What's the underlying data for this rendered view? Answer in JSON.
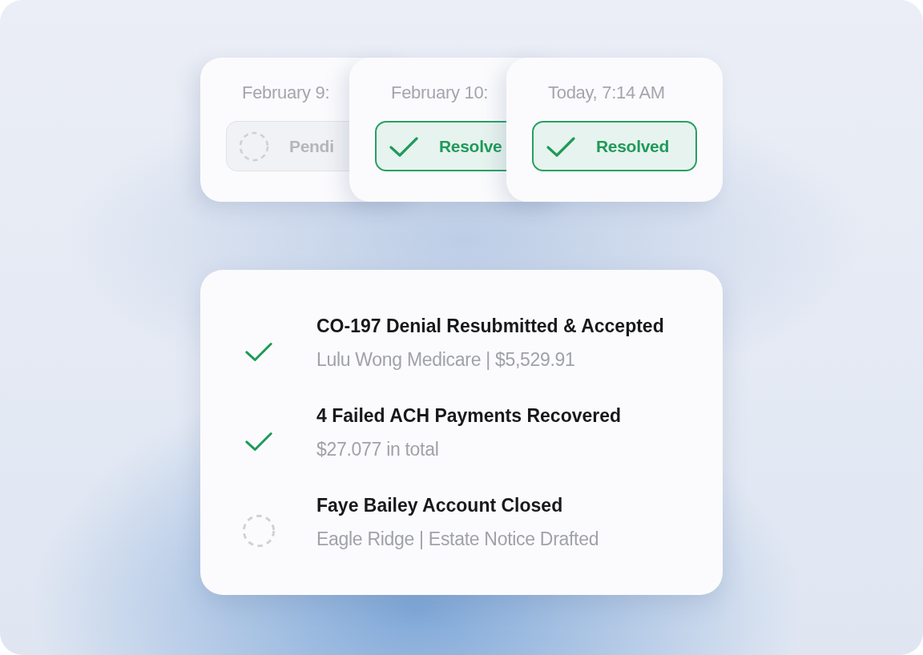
{
  "status_cards": [
    {
      "date": "February  9:",
      "status": {
        "kind": "pending",
        "label": "Pendi"
      }
    },
    {
      "date": "February  10:",
      "status": {
        "kind": "resolved",
        "label": "Resolve"
      }
    },
    {
      "date": "Today, 7:14 AM",
      "status": {
        "kind": "resolved",
        "label": "Resolved"
      }
    }
  ],
  "tasks": [
    {
      "done": true,
      "title": "CO-197 Denial Resubmitted & Accepted",
      "detail": "Lulu Wong Medicare | $5,529.91"
    },
    {
      "done": true,
      "title": "4 Failed ACH Payments Recovered",
      "detail": "$27.077 in total"
    },
    {
      "done": false,
      "title": "Faye Bailey Account Closed",
      "detail": "Eagle Ridge | Estate Notice Drafted"
    }
  ]
}
